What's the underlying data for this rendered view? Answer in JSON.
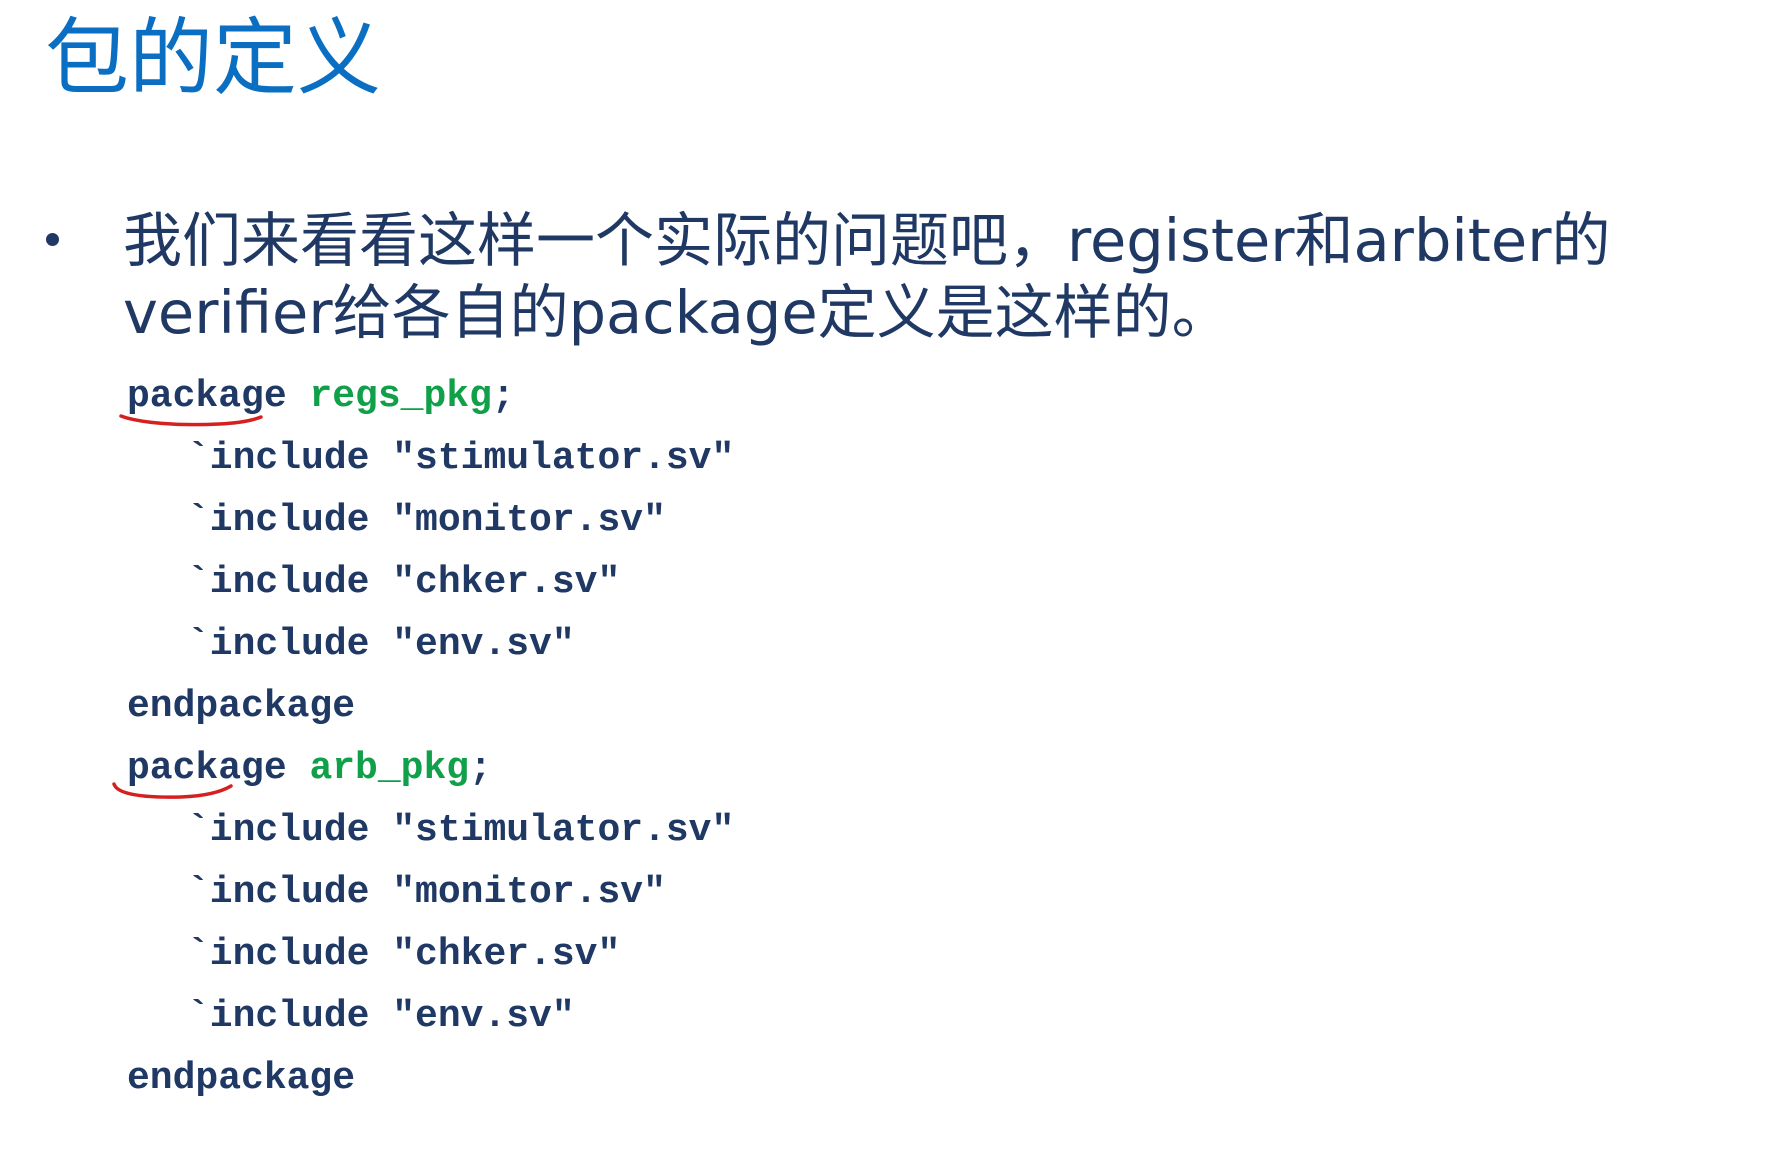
{
  "slide": {
    "title": "包的定义",
    "bullet": "我们来看看这样一个实际的问题吧，register和arbiter的verifier给各自的package定义是这样的。",
    "colors": {
      "title": "#0a6fc2",
      "text": "#1f3864",
      "package_name": "#11a04a",
      "annotation": "#d62020"
    }
  },
  "code": {
    "packages": [
      {
        "keyword": "package",
        "name": "regs_pkg",
        "terminator": ";",
        "includes": [
          "`include \"stimulator.sv\"",
          "`include \"monitor.sv\"",
          "`include \"chker.sv\"",
          "`include \"env.sv\""
        ],
        "end": "endpackage"
      },
      {
        "keyword": "package",
        "name": "arb_pkg",
        "terminator": ";",
        "includes": [
          "`include \"stimulator.sv\"",
          "`include \"monitor.sv\"",
          "`include \"chker.sv\"",
          "`include \"env.sv\""
        ],
        "end": "endpackage"
      }
    ]
  }
}
